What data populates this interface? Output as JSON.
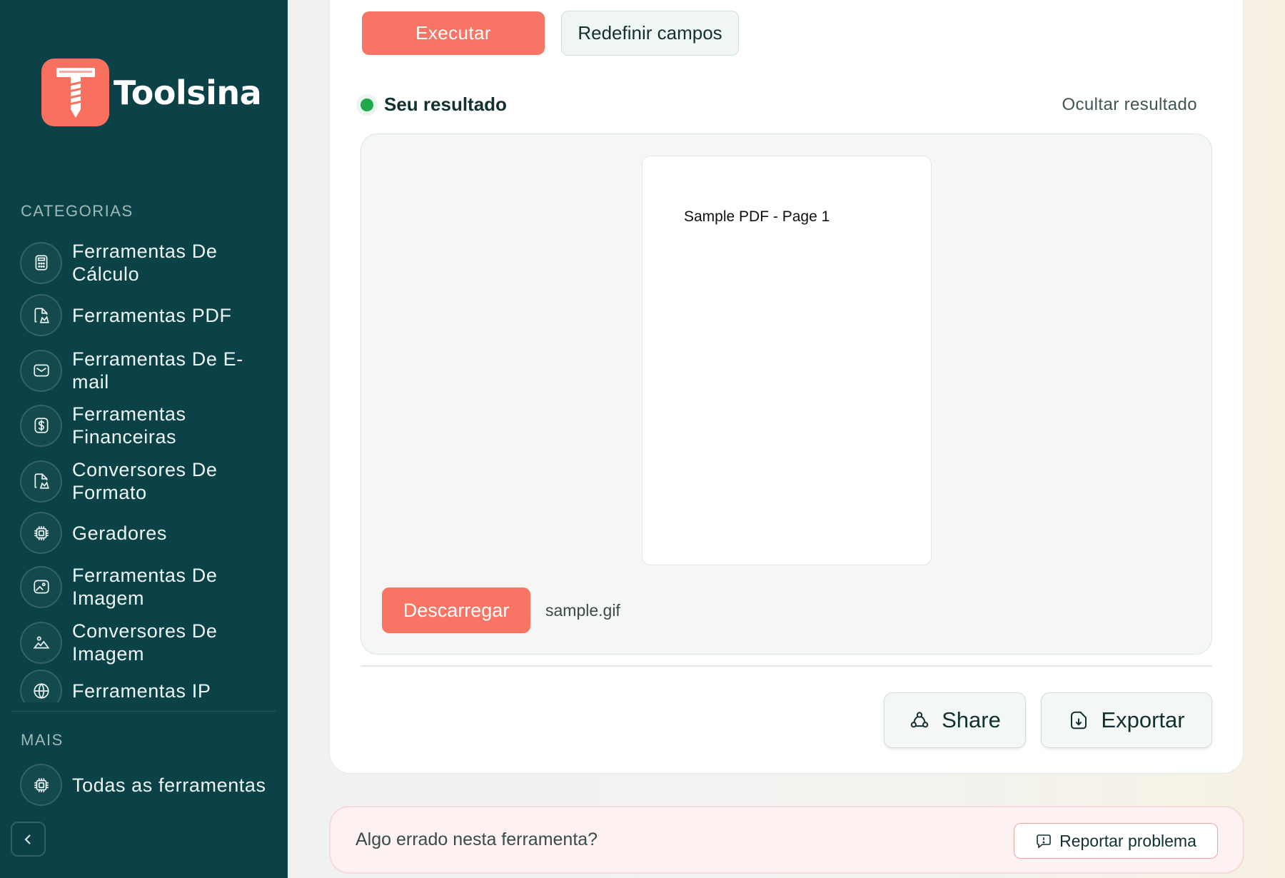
{
  "brand": {
    "name": "Toolsina",
    "accent": "#f9705e",
    "sidebar_bg": "#0b4247"
  },
  "sidebar": {
    "categories_label": "CATEGORIAS",
    "items": [
      {
        "label": "Ferramentas De Cálculo",
        "icon": "calculator-icon"
      },
      {
        "label": "Ferramentas PDF",
        "icon": "pdf-file-icon"
      },
      {
        "label": "Ferramentas De E-mail",
        "icon": "mail-icon"
      },
      {
        "label": "Ferramentas Financeiras",
        "icon": "dollar-icon"
      },
      {
        "label": "Conversores De Formato",
        "icon": "file-convert-icon"
      },
      {
        "label": "Geradores",
        "icon": "chip-icon"
      },
      {
        "label": "Ferramentas De Imagem",
        "icon": "image-icon"
      },
      {
        "label": "Conversores De Imagem",
        "icon": "landscape-icon"
      },
      {
        "label": "Ferramentas IP",
        "icon": "globe-icon"
      }
    ],
    "more_label": "MAIS",
    "all_tools": {
      "label": "Todas as ferramentas",
      "icon": "chip-icon"
    }
  },
  "toolbar": {
    "run_label": "Executar",
    "reset_label": "Redefinir campos"
  },
  "result": {
    "title": "Seu resultado",
    "hide_label": "Ocultar resultado",
    "preview_text": "Sample PDF - Page 1",
    "download_label": "Descarregar",
    "filename": "sample.gif"
  },
  "actions": {
    "share_label": "Share",
    "export_label": "Exportar"
  },
  "report": {
    "question": "Algo errado nesta ferramenta?",
    "button_label": "Reportar problema"
  }
}
